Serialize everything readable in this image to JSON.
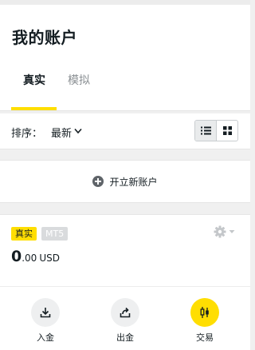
{
  "header": {
    "title": "我的账户"
  },
  "tabs": [
    {
      "label": "真实",
      "active": true
    },
    {
      "label": "模拟",
      "active": false
    }
  ],
  "sort": {
    "label": "排序：",
    "value": "最新",
    "view_mode": "list"
  },
  "open_account": {
    "label": "开立新账户"
  },
  "account": {
    "type_badge": "真实",
    "platform_badge": "MT5",
    "balance_int": "0",
    "balance_dec": ".00",
    "currency": "USD"
  },
  "actions": {
    "deposit": "入金",
    "withdraw": "出金",
    "trade": "交易"
  },
  "colors": {
    "accent": "#ffde02",
    "text": "#141d22",
    "muted": "#8a8f93"
  }
}
